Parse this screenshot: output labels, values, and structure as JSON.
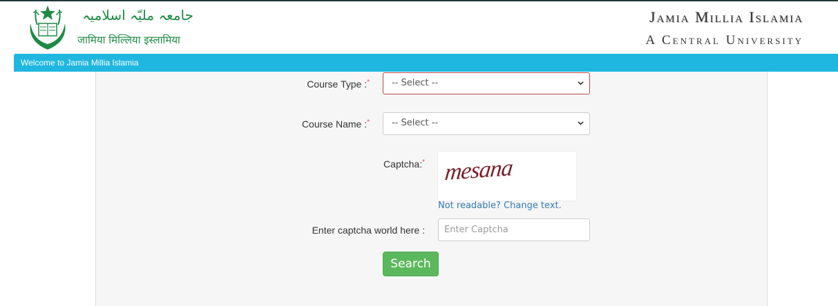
{
  "header": {
    "urdu_name": "جامعہ ملیّہ اسلامیہ",
    "hindi_name": "जामिया मिल्लिया इस्लामिया",
    "university_name": "Jamia Millia Islamia",
    "university_subtitle": "A Central University"
  },
  "welcome_bar": {
    "text": "Welcome to Jamia Millia Islamia"
  },
  "form": {
    "course_type": {
      "label": "Course Type :",
      "required_mark": "*",
      "selected": "-- Select --"
    },
    "course_name": {
      "label": "Course Name :",
      "required_mark": "*",
      "selected": "-- Select --"
    },
    "captcha": {
      "label": "Captcha:",
      "required_mark": "*",
      "image_text": "mesana",
      "change_link": "Not readable? Change text."
    },
    "captcha_input": {
      "label": "Enter captcha world here :",
      "placeholder": "Enter Captcha",
      "value": ""
    },
    "search_button": "Search"
  },
  "colors": {
    "accent_bar": "#1fb7df",
    "brand_green": "#1d8a44",
    "button_green": "#5cb85c",
    "link_blue": "#337ab7",
    "error_border": "#b94a48"
  }
}
